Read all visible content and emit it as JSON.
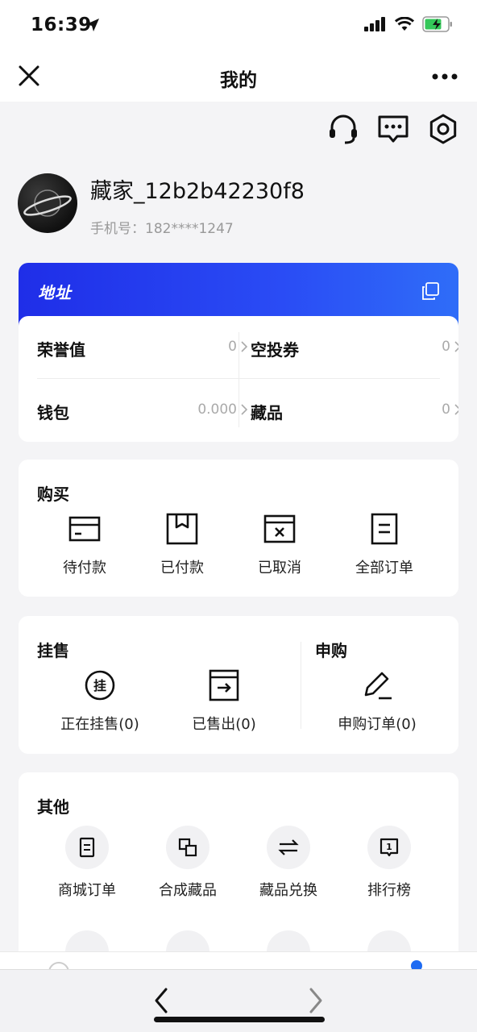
{
  "status_bar": {
    "time": "16:39"
  },
  "navbar": {
    "title": "我的"
  },
  "profile": {
    "username": "藏家_12b2b42230f8",
    "phone_label": "手机号：",
    "phone": "182****1247"
  },
  "address_card": {
    "title": "地址",
    "stats": [
      {
        "label": "荣誉值",
        "value": "0"
      },
      {
        "label": "空投券",
        "value": "0"
      },
      {
        "label": "钱包",
        "value": "0.000"
      },
      {
        "label": "藏品",
        "value": "0"
      }
    ]
  },
  "purchase": {
    "title": "购买",
    "items": [
      "待付款",
      "已付款",
      "已取消",
      "全部订单"
    ]
  },
  "listing": {
    "title": "挂售",
    "items": [
      "正在挂售(0)",
      "已售出(0)"
    ]
  },
  "subscribe": {
    "title": "申购",
    "items": [
      "申购订单(0)"
    ]
  },
  "others": {
    "title": "其他",
    "items": [
      "商城订单",
      "合成藏品",
      "藏品兑换",
      "排行榜"
    ]
  },
  "colors": {
    "accent_blue": "#1f2ee8",
    "accent_blue_end": "#2f6df8",
    "tab_dot": "#1e6bf2"
  }
}
